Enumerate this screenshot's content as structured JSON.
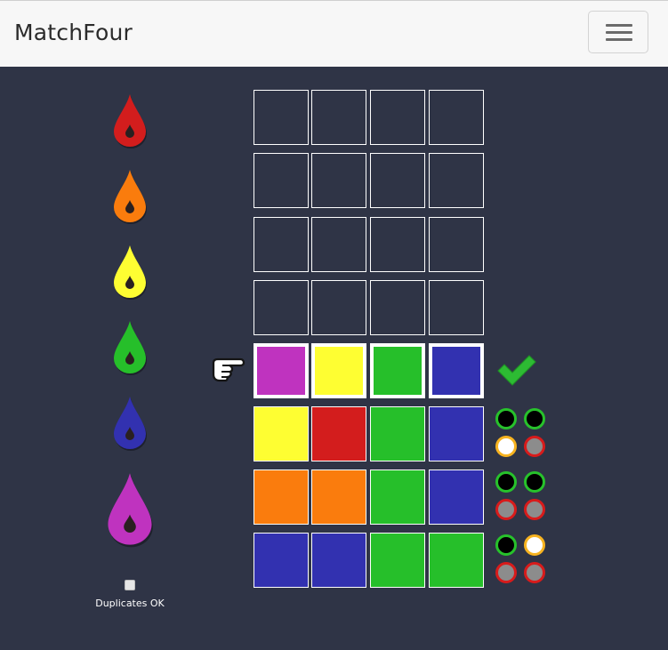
{
  "header": {
    "brand": "MatchFour",
    "menu_icon": "hamburger-menu-icon"
  },
  "colors": {
    "red": "#d31d1d",
    "orange": "#fa7c0d",
    "yellow": "#fefe32",
    "green": "#26bf2a",
    "blue": "#3231b0",
    "purple": "#bf33bf",
    "empty": "#2f3446",
    "peg_black": "#000000",
    "peg_white": "#ffffff",
    "peg_empty": "#8c8c8c",
    "peg_ring_green": "#27c22b",
    "peg_ring_orange": "#f7b320",
    "peg_ring_red": "#d81b1b",
    "check": "#2dbb33"
  },
  "palette": [
    "red",
    "orange",
    "yellow",
    "green",
    "blue",
    "purple"
  ],
  "options": {
    "duplicates_label": "Duplicates OK",
    "duplicates_checked": false
  },
  "board": {
    "rows": [
      {
        "cells": [
          "empty",
          "empty",
          "empty",
          "empty"
        ],
        "state": "empty"
      },
      {
        "cells": [
          "empty",
          "empty",
          "empty",
          "empty"
        ],
        "state": "empty"
      },
      {
        "cells": [
          "empty",
          "empty",
          "empty",
          "empty"
        ],
        "state": "empty"
      },
      {
        "cells": [
          "empty",
          "empty",
          "empty",
          "empty"
        ],
        "state": "empty"
      },
      {
        "cells": [
          "purple",
          "yellow",
          "green",
          "blue"
        ],
        "state": "active"
      },
      {
        "cells": [
          "yellow",
          "red",
          "green",
          "blue"
        ],
        "state": "scored",
        "pegs": [
          "black",
          "black",
          "white",
          "none"
        ]
      },
      {
        "cells": [
          "orange",
          "orange",
          "green",
          "blue"
        ],
        "state": "scored",
        "pegs": [
          "black",
          "black",
          "none",
          "none"
        ]
      },
      {
        "cells": [
          "blue",
          "blue",
          "green",
          "green"
        ],
        "state": "scored",
        "pegs": [
          "black",
          "white",
          "none",
          "none"
        ]
      }
    ]
  },
  "icons": {
    "pointer": "pointing-hand-icon",
    "submit": "checkmark-icon",
    "drop": "drop-icon"
  }
}
